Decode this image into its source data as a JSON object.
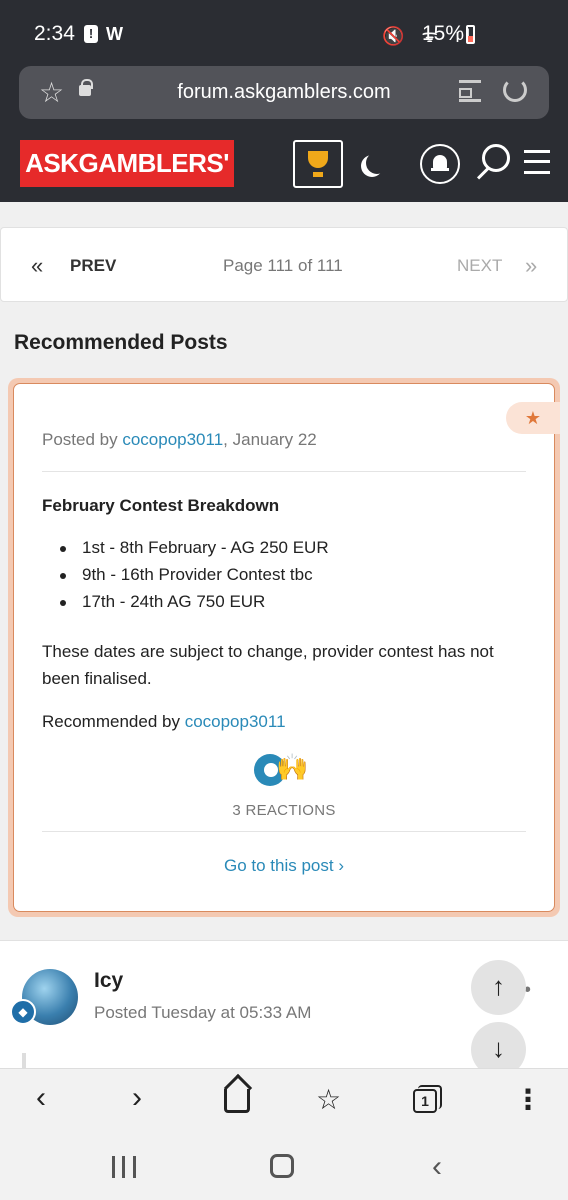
{
  "status_bar": {
    "time": "2:34",
    "alert_glyph": "!",
    "app_letter": "W",
    "signal_icons": "🔇 ᯤ ıl",
    "battery_percent": "15%"
  },
  "browser": {
    "url": "forum.askgamblers.com",
    "tab_count": "1"
  },
  "site": {
    "logo_text": "ASKGAMBLERS'"
  },
  "pagination": {
    "prev_label": "PREV",
    "page_label": "Page 111 of 111",
    "next_label": "NEXT"
  },
  "recommended": {
    "section_title": "Recommended Posts",
    "posted_prefix": "Posted by ",
    "author": "cocopop3011",
    "date": ", January 22",
    "contest_title": "February Contest Breakdown",
    "bullets": [
      "1st - 8th February - AG 250 EUR",
      "9th - 16th Provider Contest tbc",
      "17th - 24th AG 750 EUR"
    ],
    "body": "These dates are subject to change, provider contest has not been finalised.",
    "recommended_prefix": "Recommended by ",
    "recommended_by": "cocopop3011",
    "reactions_label": "3 REACTIONS",
    "goto_label": "Go to this post ›"
  },
  "next_post": {
    "author": "Icy",
    "posted": "Posted Tuesday at 05:33 AM"
  },
  "icons": {
    "accent": "#2a8ab8",
    "brand_red": "#e62a2a",
    "trophy": "#f0a81a",
    "highlight_border": "#d98a5e"
  }
}
